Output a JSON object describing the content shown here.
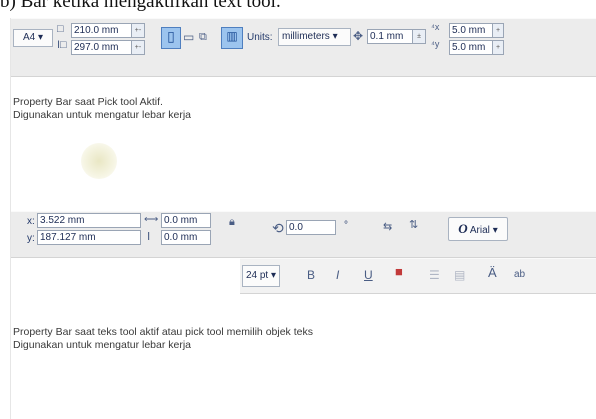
{
  "heading": "b) Bar ketika mengaktifkan text tool.",
  "bar1": {
    "paper_size": "A4",
    "width": "210.0 mm",
    "height": "297.0 mm",
    "units_label": "Units:",
    "units_value": "millimeters",
    "nudge": "0.1 mm",
    "dup_x": "5.0 mm",
    "dup_y": "5.0 mm",
    "colors": {
      "bar": "#ececec",
      "selected": "#9cc4ee",
      "icon": "#4a5d84"
    }
  },
  "note1": {
    "line1": "Property Bar saat Pick tool Aktif.",
    "line2": "Digunakan untuk mengatur lebar kerja"
  },
  "bar2": {
    "x_label": "x:",
    "x_value": "3.522 mm",
    "y_label": "y:",
    "y_value": "187.127 mm",
    "w_value": "0.0 mm",
    "h_value": "0.0 mm",
    "rotation": "0.0",
    "degree": "°",
    "font_name": "Arial",
    "font_size": "24 pt"
  },
  "note2": {
    "line1": "Property Bar saat teks tool aktif atau pick tool memilih objek teks",
    "line2": "Digunakan untuk mengatur lebar kerja"
  }
}
